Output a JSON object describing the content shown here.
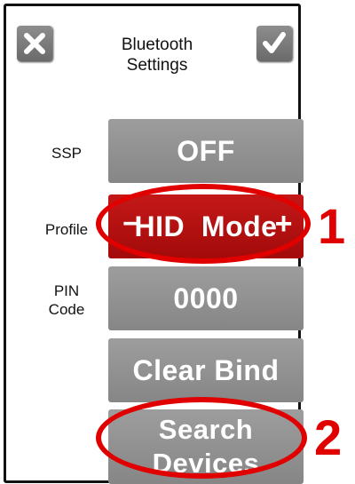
{
  "header": {
    "title_line1": "Bluetooth",
    "title_line2": "Settings",
    "cancel_icon": "close-icon",
    "confirm_icon": "check-icon"
  },
  "rows": [
    {
      "label": "SSP",
      "value": "OFF"
    },
    {
      "label": "Profile",
      "value": "HID  Mode",
      "decrement": "−",
      "increment": "+"
    },
    {
      "label_line1": "PIN",
      "label_line2": "Code",
      "value": "0000"
    },
    {
      "value": "Clear Bind"
    },
    {
      "value_line1": "Search",
      "value_line2": "Devices"
    }
  ],
  "callouts": [
    "1",
    "2"
  ],
  "colors": {
    "accent": "#e00000",
    "tile": "#8f8f8f",
    "tile_active": "#b31010"
  }
}
